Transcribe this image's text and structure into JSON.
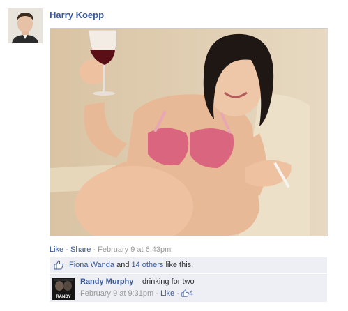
{
  "post": {
    "author": "Harry Koepp",
    "actions": {
      "like": "Like",
      "share": "Share",
      "sep": "·",
      "timestamp": "February 9 at 6:43pm"
    }
  },
  "likes": {
    "name": "Fiona Wanda",
    "and": "and",
    "others": "14 others",
    "suffix": "like this."
  },
  "comment": {
    "author": "Randy Murphy",
    "text": "drinking for two",
    "timestamp": "February 9 at 9:31pm",
    "sep": "·",
    "like": "Like",
    "like_count": "4",
    "avatar_caption": "RANDY"
  },
  "icons": {
    "like": "thumbs-up-icon"
  },
  "colors": {
    "link": "#3b5998",
    "panel": "#edeff4",
    "muted": "#999999"
  }
}
